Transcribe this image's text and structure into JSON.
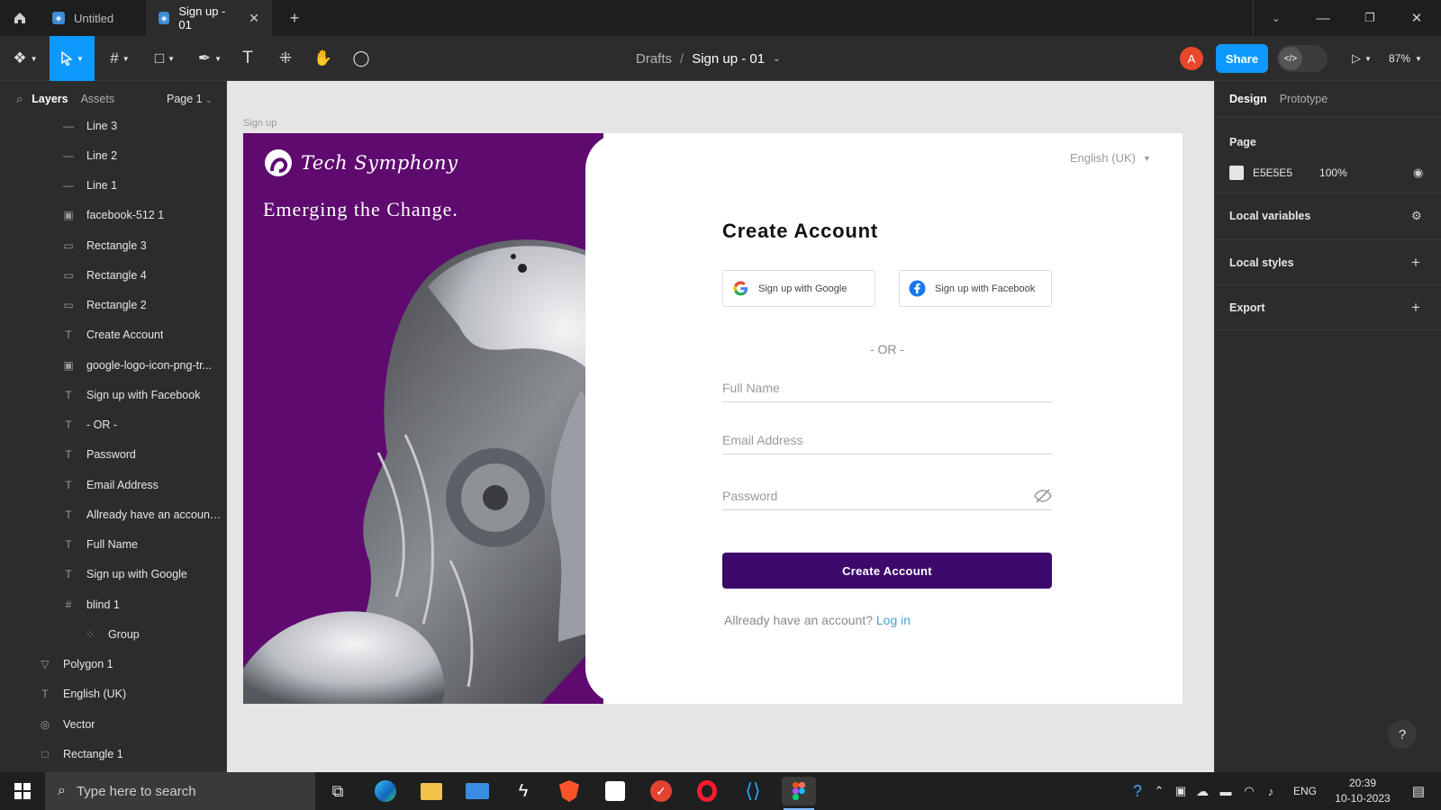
{
  "titlebar": {
    "tabs": [
      {
        "label": "Untitled"
      },
      {
        "label": "Sign up - 01"
      }
    ]
  },
  "toolbar": {
    "breadcrumb_parent": "Drafts",
    "breadcrumb_sep": "/",
    "file_name": "Sign up - 01",
    "avatar_letter": "A",
    "share_label": "Share",
    "zoom": "87%"
  },
  "left_panel": {
    "tab_layers": "Layers",
    "tab_assets": "Assets",
    "page_label": "Page 1",
    "layers": [
      {
        "name": "Line 3",
        "icon": "line-icon",
        "glyph": "—",
        "indent": 1
      },
      {
        "name": "Line 2",
        "icon": "line-icon",
        "glyph": "—",
        "indent": 1
      },
      {
        "name": "Line 1",
        "icon": "line-icon",
        "glyph": "—",
        "indent": 1
      },
      {
        "name": "facebook-512 1",
        "icon": "image-icon",
        "glyph": "▣",
        "indent": 1
      },
      {
        "name": "Rectangle 3",
        "icon": "rectangle-icon",
        "glyph": "▭",
        "indent": 1
      },
      {
        "name": "Rectangle 4",
        "icon": "rectangle-icon",
        "glyph": "▭",
        "indent": 1
      },
      {
        "name": "Rectangle 2",
        "icon": "rectangle-icon",
        "glyph": "▭",
        "indent": 1
      },
      {
        "name": "Create Account",
        "icon": "text-icon",
        "glyph": "T",
        "indent": 1
      },
      {
        "name": "google-logo-icon-png-tr...",
        "icon": "image-icon",
        "glyph": "▣",
        "indent": 1
      },
      {
        "name": "Sign up with Facebook",
        "icon": "text-icon",
        "glyph": "T",
        "indent": 1
      },
      {
        "name": "- OR -",
        "icon": "text-icon",
        "glyph": "T",
        "indent": 1
      },
      {
        "name": "Password",
        "icon": "text-icon",
        "glyph": "T",
        "indent": 1
      },
      {
        "name": "Email Address",
        "icon": "text-icon",
        "glyph": "T",
        "indent": 1
      },
      {
        "name": "Allready have an account...",
        "icon": "text-icon",
        "glyph": "T",
        "indent": 1
      },
      {
        "name": "Full Name",
        "icon": "text-icon",
        "glyph": "T",
        "indent": 1
      },
      {
        "name": "Sign up with Google",
        "icon": "text-icon",
        "glyph": "T",
        "indent": 1
      },
      {
        "name": "blind 1",
        "icon": "frame-icon",
        "glyph": "#",
        "indent": 1
      },
      {
        "name": "Group",
        "icon": "group-icon",
        "glyph": "⁘",
        "indent": 2
      },
      {
        "name": "Polygon 1",
        "icon": "polygon-icon",
        "glyph": "▽",
        "indent": 0
      },
      {
        "name": "English (UK)",
        "icon": "text-icon",
        "glyph": "T",
        "indent": 0
      },
      {
        "name": "Vector",
        "icon": "vector-icon",
        "glyph": "◎",
        "indent": 0
      },
      {
        "name": "Rectangle 1",
        "icon": "rectangle-icon",
        "glyph": "□",
        "indent": 0
      }
    ]
  },
  "canvas": {
    "frame_label": "Sign up",
    "brand_name": "Tech Symphony",
    "tagline": "Emerging the Change.",
    "language": "English (UK)",
    "heading": "Create Account",
    "google_btn": "Sign up with Google",
    "facebook_btn": "Sign up with Facebook",
    "or_text": "- OR -",
    "full_name_placeholder": "Full Name",
    "email_placeholder": "Email Address",
    "password_placeholder": "Password",
    "submit_label": "Create Account",
    "login_prompt": "Allready have an account?",
    "login_link": "Log in",
    "purple_color": "#5e0a6e",
    "button_color": "#3d0a6b",
    "link_color": "#49a3c7"
  },
  "right_panel": {
    "tab_design": "Design",
    "tab_prototype": "Prototype",
    "page_section": "Page",
    "page_color": "E5E5E5",
    "page_opacity": "100%",
    "local_variables": "Local variables",
    "local_styles": "Local styles",
    "export": "Export",
    "help": "?"
  },
  "taskbar": {
    "search_placeholder": "Type here to search",
    "language": "ENG",
    "time": "20:39",
    "date": "10-10-2023"
  }
}
